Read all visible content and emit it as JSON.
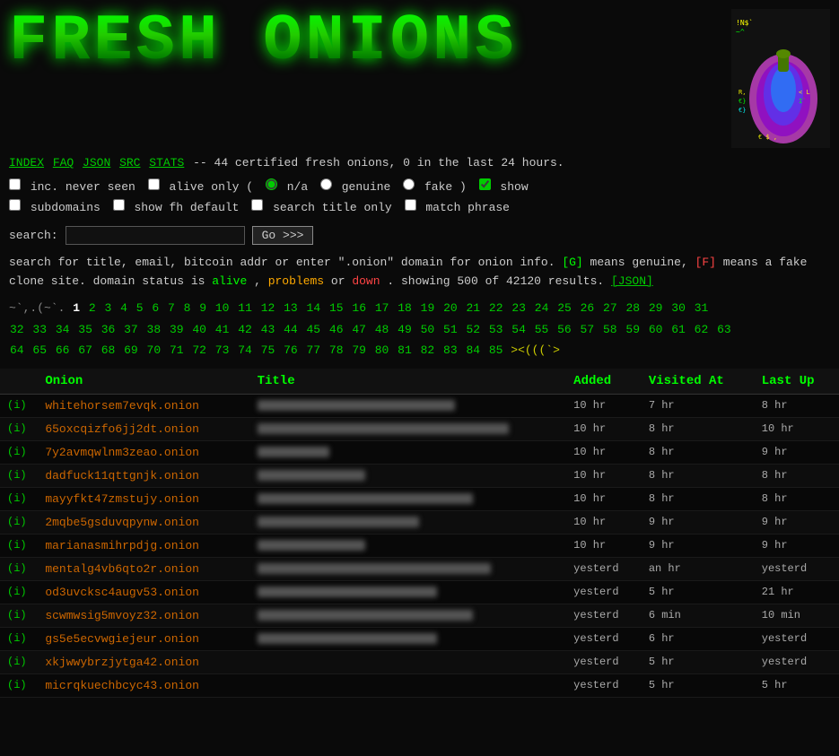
{
  "header": {
    "title": "FRESH ONIONS",
    "tagline": "-- 44 certified fresh onions, 0 in the last 24 hours."
  },
  "nav": {
    "items": [
      {
        "label": "INDEX",
        "href": "#"
      },
      {
        "label": "FAQ",
        "href": "#"
      },
      {
        "label": "JSON",
        "href": "#"
      },
      {
        "label": "SRC",
        "href": "#"
      },
      {
        "label": "STATS",
        "href": "#"
      }
    ]
  },
  "options": {
    "inc_never_seen_label": "inc. never seen",
    "alive_only_label": "alive only (",
    "na_label": "n/a",
    "genuine_label": "genuine",
    "fake_label": "fake )",
    "show_label": "show",
    "subdomains_label": "subdomains",
    "show_fh_default_label": "show fh default",
    "search_title_only_label": "search title only",
    "match_phrase_label": "match phrase"
  },
  "search": {
    "label": "search:",
    "placeholder": "",
    "button_label": "Go >>>"
  },
  "info": {
    "line1": "search for title, email, bitcoin addr or enter \".onion\" domain for onion info.",
    "genuine_badge": "[G]",
    "genuine_note": "means genuine,",
    "fake_badge": "[F]",
    "fake_note": "means a fake",
    "line2": "clone site. domain status is",
    "alive_text": "alive",
    "comma1": ",",
    "problems_text": "problems",
    "or_text": "or",
    "down_text": "down",
    "period": ".",
    "showing": "showing 500 of 42120 results.",
    "json_link": "[JSON]"
  },
  "pagination": {
    "tilde_prefix": "~`,.(~`.",
    "current": "1",
    "pages": [
      "2",
      "3",
      "4",
      "5",
      "6",
      "7",
      "8",
      "9",
      "10",
      "11",
      "12",
      "13",
      "14",
      "15",
      "16",
      "17",
      "18",
      "19",
      "20",
      "21",
      "22",
      "23",
      "24",
      "25",
      "26",
      "27",
      "28",
      "29",
      "30",
      "31",
      "32",
      "33",
      "34",
      "35",
      "36",
      "37",
      "38",
      "39",
      "40",
      "41",
      "42",
      "43",
      "44",
      "45",
      "46",
      "47",
      "48",
      "49",
      "50",
      "51",
      "52",
      "53",
      "54",
      "55",
      "56",
      "57",
      "58",
      "59",
      "60",
      "61",
      "62",
      "63",
      "64",
      "65",
      "66",
      "67",
      "68",
      "69",
      "70",
      "71",
      "72",
      "73",
      "74",
      "75",
      "76",
      "77",
      "78",
      "79",
      "80",
      "81",
      "82",
      "83",
      "84",
      "85"
    ],
    "special": "><(((`>"
  },
  "table": {
    "headers": {
      "i": "",
      "onion": "Onion",
      "title": "Title",
      "added": "Added",
      "visited_at": "Visited At",
      "last_up": "Last Up"
    },
    "rows": [
      {
        "i": "(i)",
        "onion": "whitehorsem7evqk.onion",
        "title_blur": true,
        "title_width": 220,
        "added": "10 hr",
        "visited": "7 hr",
        "lastup": "8 hr"
      },
      {
        "i": "(i)",
        "onion": "65oxcqizfo6jj2dt.onion",
        "title_blur": true,
        "title_width": 280,
        "added": "10 hr",
        "visited": "8 hr",
        "lastup": "10 hr"
      },
      {
        "i": "(i)",
        "onion": "7y2avmqwlnm3zeao.onion",
        "title_blur": true,
        "title_width": 80,
        "added": "10 hr",
        "visited": "8 hr",
        "lastup": "9 hr"
      },
      {
        "i": "(i)",
        "onion": "dadfuck11qttgnjk.onion",
        "title_blur": true,
        "title_width": 120,
        "added": "10 hr",
        "visited": "8 hr",
        "lastup": "8 hr"
      },
      {
        "i": "(i)",
        "onion": "mayyfkt47zmstujy.onion",
        "title_blur": true,
        "title_width": 240,
        "added": "10 hr",
        "visited": "8 hr",
        "lastup": "8 hr"
      },
      {
        "i": "(i)",
        "onion": "2mqbe5gsduvqpynw.onion",
        "title_blur": true,
        "title_width": 180,
        "added": "10 hr",
        "visited": "9 hr",
        "lastup": "9 hr"
      },
      {
        "i": "(i)",
        "onion": "marianasmihrpdjg.onion",
        "title_blur": true,
        "title_width": 120,
        "added": "10 hr",
        "visited": "9 hr",
        "lastup": "9 hr"
      },
      {
        "i": "(i)",
        "onion": "mentalg4vb6qto2r.onion",
        "title_blur": true,
        "title_width": 260,
        "added": "yesterd",
        "visited": "an hr",
        "lastup": "yesterd"
      },
      {
        "i": "(i)",
        "onion": "od3uvcksc4augv53.onion",
        "title_blur": true,
        "title_width": 200,
        "added": "yesterd",
        "visited": "5 hr",
        "lastup": "21 hr"
      },
      {
        "i": "(i)",
        "onion": "scwmwsig5mvoyz32.onion",
        "title_blur": true,
        "title_width": 240,
        "added": "yesterd",
        "visited": "6 min",
        "lastup": "10 min"
      },
      {
        "i": "(i)",
        "onion": "gs5e5ecvwgiejeur.onion",
        "title_blur": true,
        "title_width": 200,
        "added": "yesterd",
        "visited": "6 hr",
        "lastup": "yesterd"
      },
      {
        "i": "(i)",
        "onion": "xkjwwybrzjytga42.onion",
        "title_blur": true,
        "title_width": 0,
        "added": "yesterd",
        "visited": "5 hr",
        "lastup": "yesterd"
      },
      {
        "i": "(i)",
        "onion": "micrqkuechbcyc43.onion",
        "title_blur": true,
        "title_width": 0,
        "added": "yesterd",
        "visited": "5 hr",
        "lastup": "5 hr"
      }
    ]
  }
}
